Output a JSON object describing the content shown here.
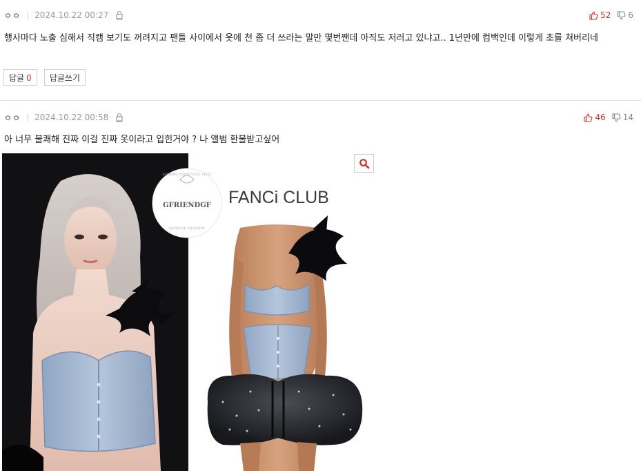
{
  "comments": [
    {
      "author": "ㅇㅇ",
      "date": "2024.10.22 00:27",
      "likes": "52",
      "dislikes": "6",
      "text": "행사마다 노출 심해서 직캠 보기도 꺼려지고 팬들 사이에서 옷에 천 좀 더 쓰라는 말만 몇번짼데 아직도 저러고 있냐고.. 1년만에 컴백인데 이렇게 초를 쳐버리네",
      "reply_label": "답글",
      "reply_count": "0",
      "write_reply_label": "답글쓰기"
    },
    {
      "author": "ㅇㅇ",
      "date": "2024.10.22 00:58",
      "likes": "46",
      "dislikes": "14",
      "text": "아 너무 불쾌해 진짜 이걸 진짜 옷이라고 입힌거야 ? 나 앨범 환불받고싶어",
      "image": {
        "logo_circle_top": "SOWON·YERIN·YUJU·VIVIZ",
        "logo_circle_name": "GFRIENDGF",
        "logo_circle_bottom": "GFRIEND FASHION",
        "brand_text": "FANCi CLUB"
      }
    }
  ],
  "icons": {
    "like": "thumb-up-icon",
    "dislike": "thumb-down-icon",
    "lock": "lock-icon",
    "zoom": "search-icon"
  },
  "colors": {
    "like": "#c0392b",
    "dislike": "#888888",
    "reply_count": "#e0392b",
    "zoom_icon": "#c0392b"
  }
}
